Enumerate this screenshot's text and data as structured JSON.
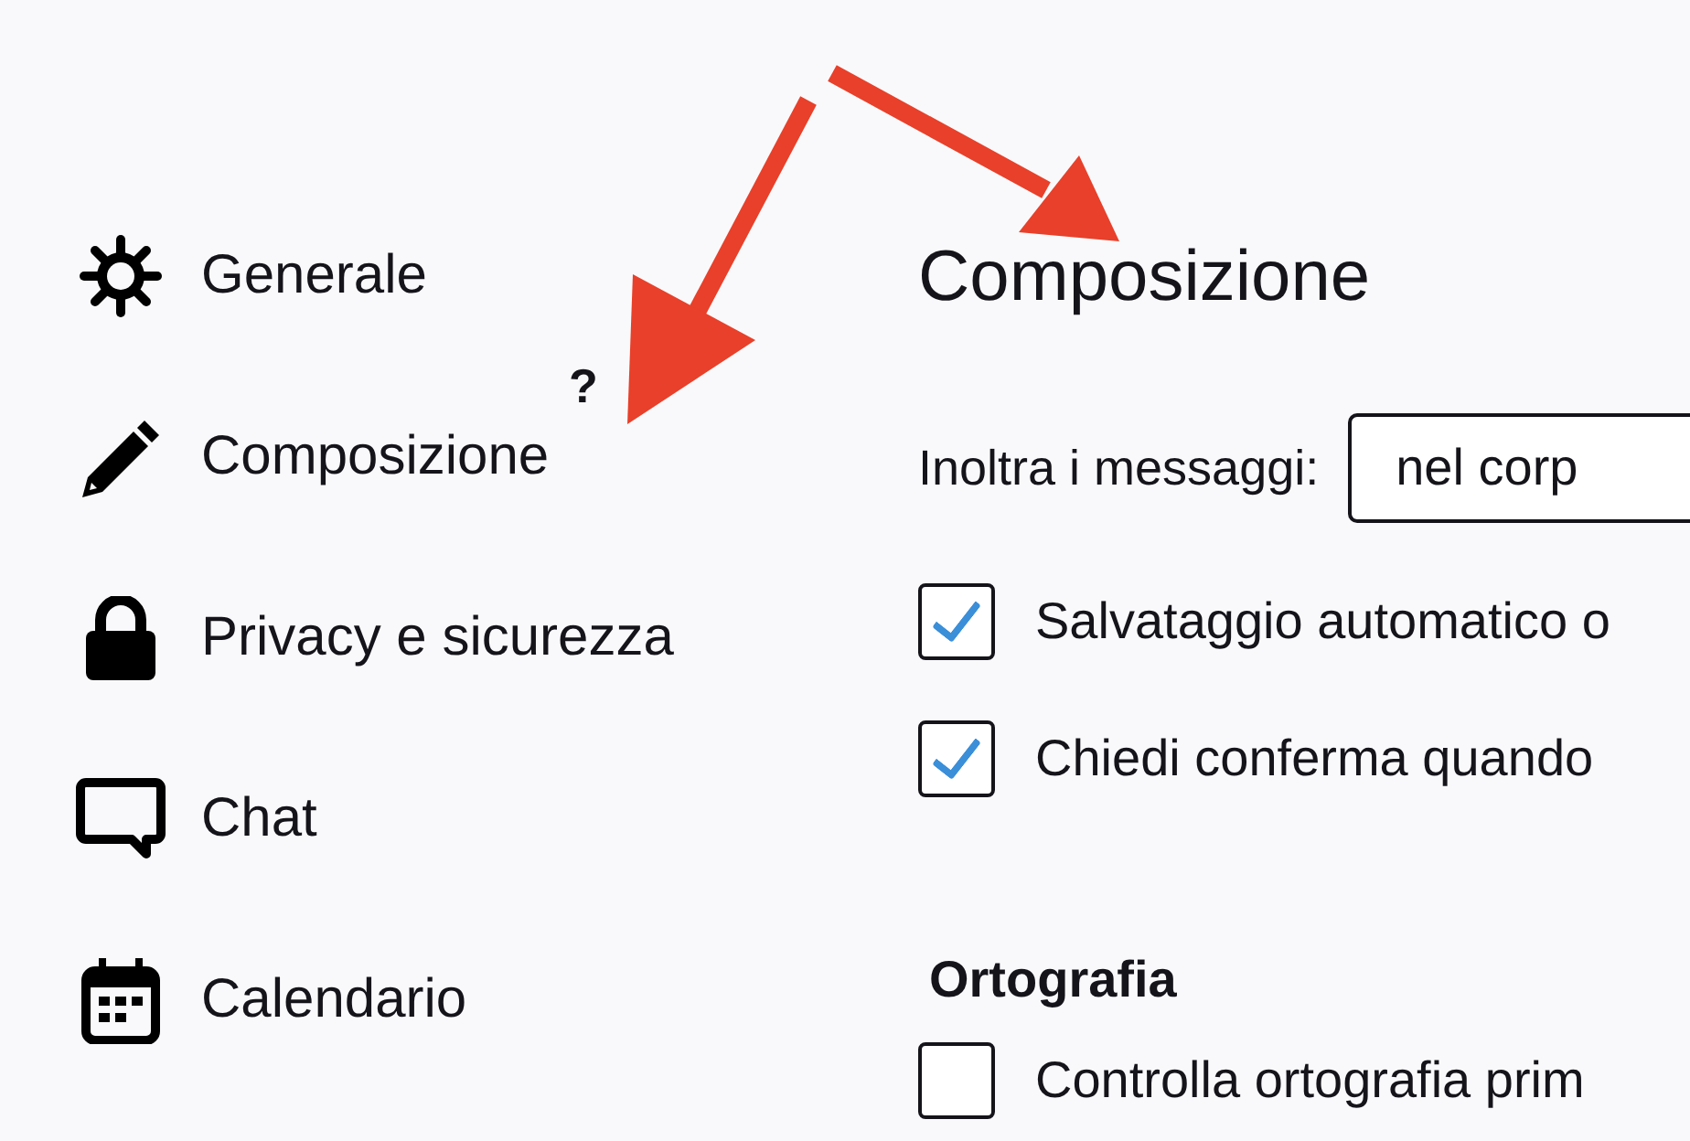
{
  "sidebar": {
    "items": [
      {
        "label": "Generale"
      },
      {
        "label": "Composizione"
      },
      {
        "label": "Privacy e sicurezza"
      },
      {
        "label": "Chat"
      },
      {
        "label": "Calendario"
      }
    ]
  },
  "pane": {
    "title": "Composizione",
    "forward": {
      "label": "Inoltra i messaggi:",
      "value": "nel corp"
    },
    "options": [
      {
        "label": "Salvataggio automatico o",
        "checked": true
      },
      {
        "label": "Chiedi conferma quando",
        "checked": true
      }
    ],
    "sections": [
      {
        "heading": "Ortografia",
        "options": [
          {
            "label": "Controlla ortografia prim",
            "checked": false
          }
        ]
      }
    ]
  },
  "annotations": {
    "note": "?"
  }
}
